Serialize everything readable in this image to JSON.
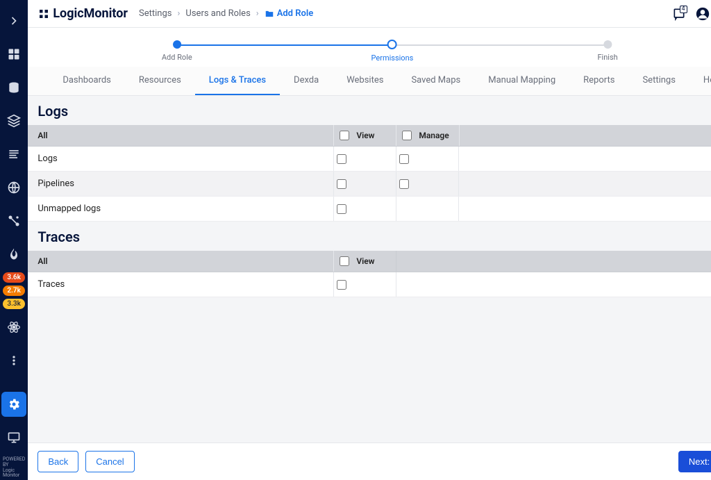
{
  "logo_text": "LogicMonitor",
  "breadcrumb": {
    "settings": "Settings",
    "users_roles": "Users and Roles",
    "current": "Add Role"
  },
  "notification_count": "4",
  "wizard": {
    "step1": "Add Role",
    "step2": "Permissions",
    "step3": "Finish"
  },
  "tabs": [
    "Dashboards",
    "Resources",
    "Logs & Traces",
    "Dexda",
    "Websites",
    "Saved Maps",
    "Manual Mapping",
    "Reports",
    "Settings",
    "Help"
  ],
  "sections": {
    "logs": {
      "title": "Logs",
      "header_all": "All",
      "header_view": "View",
      "header_manage": "Manage",
      "rows": [
        "Logs",
        "Pipelines",
        "Unmapped logs"
      ]
    },
    "traces": {
      "title": "Traces",
      "header_all": "All",
      "header_view": "View",
      "rows": [
        "Traces"
      ]
    }
  },
  "sidebar_badges": [
    {
      "text": "3.6k",
      "bg": "#e64a19"
    },
    {
      "text": "2.7k",
      "bg": "#f57c00"
    },
    {
      "text": "3.3k",
      "bg": "#fbc02d"
    }
  ],
  "footer": {
    "back": "Back",
    "cancel": "Cancel",
    "next": "Next: Finish"
  },
  "powered": "POWERED BY\nLogic\nMonitor"
}
